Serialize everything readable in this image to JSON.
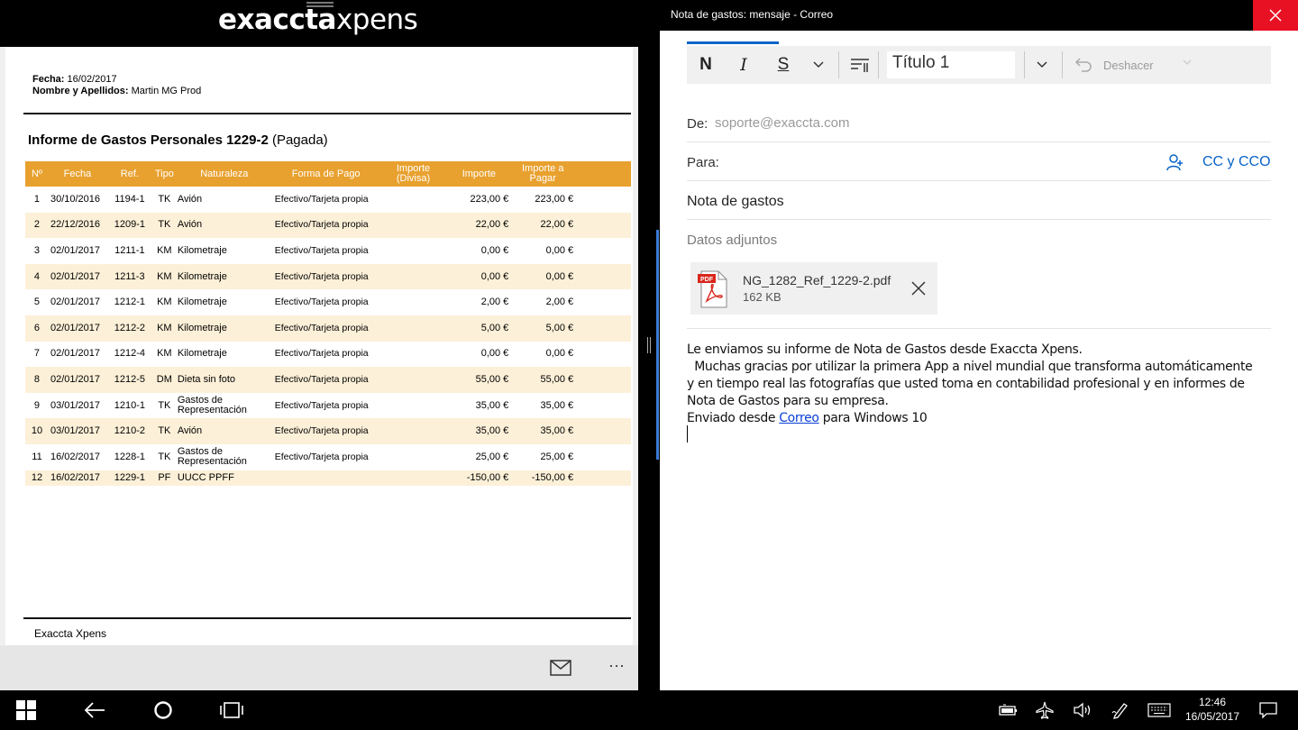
{
  "left_app": {
    "logo_bold": "exaccta",
    "logo_light": "xpens",
    "report": {
      "fecha_label": "Fecha:",
      "fecha_value": "16/02/2017",
      "nombre_label": "Nombre y Apellidos:",
      "nombre_value": "Martin MG Prod",
      "title": "Informe de Gastos Personales 1229-2",
      "status": "(Pagada)",
      "columns": [
        "Nº",
        "Fecha",
        "Ref.",
        "Tipo",
        "Naturaleza",
        "Forma de Pago",
        "Importe (Divisa)",
        "Importe",
        "Importe a Pagar"
      ],
      "rows": [
        {
          "n": "1",
          "fecha": "30/10/2016",
          "ref": "1194-1",
          "tipo": "TK",
          "naturaleza": "Avión",
          "forma_pago": "Efectivo/Tarjeta propia",
          "importe_divisa": "",
          "importe": "223,00 €",
          "importe_pagar": "223,00 €"
        },
        {
          "n": "2",
          "fecha": "22/12/2016",
          "ref": "1209-1",
          "tipo": "TK",
          "naturaleza": "Avión",
          "forma_pago": "Efectivo/Tarjeta propia",
          "importe_divisa": "",
          "importe": "22,00 €",
          "importe_pagar": "22,00 €"
        },
        {
          "n": "3",
          "fecha": "02/01/2017",
          "ref": "1211-1",
          "tipo": "KM",
          "naturaleza": "Kilometraje",
          "forma_pago": "Efectivo/Tarjeta propia",
          "importe_divisa": "",
          "importe": "0,00 €",
          "importe_pagar": "0,00 €"
        },
        {
          "n": "4",
          "fecha": "02/01/2017",
          "ref": "1211-3",
          "tipo": "KM",
          "naturaleza": "Kilometraje",
          "forma_pago": "Efectivo/Tarjeta propia",
          "importe_divisa": "",
          "importe": "0,00 €",
          "importe_pagar": "0,00 €"
        },
        {
          "n": "5",
          "fecha": "02/01/2017",
          "ref": "1212-1",
          "tipo": "KM",
          "naturaleza": "Kilometraje",
          "forma_pago": "Efectivo/Tarjeta propia",
          "importe_divisa": "",
          "importe": "2,00 €",
          "importe_pagar": "2,00 €"
        },
        {
          "n": "6",
          "fecha": "02/01/2017",
          "ref": "1212-2",
          "tipo": "KM",
          "naturaleza": "Kilometraje",
          "forma_pago": "Efectivo/Tarjeta propia",
          "importe_divisa": "",
          "importe": "5,00 €",
          "importe_pagar": "5,00 €"
        },
        {
          "n": "7",
          "fecha": "02/01/2017",
          "ref": "1212-4",
          "tipo": "KM",
          "naturaleza": "Kilometraje",
          "forma_pago": "Efectivo/Tarjeta propia",
          "importe_divisa": "",
          "importe": "0,00 €",
          "importe_pagar": "0,00 €"
        },
        {
          "n": "8",
          "fecha": "02/01/2017",
          "ref": "1212-5",
          "tipo": "DM",
          "naturaleza": "Dieta sin foto",
          "forma_pago": "Efectivo/Tarjeta propia",
          "importe_divisa": "",
          "importe": "55,00 €",
          "importe_pagar": "55,00 €"
        },
        {
          "n": "9",
          "fecha": "03/01/2017",
          "ref": "1210-1",
          "tipo": "TK",
          "naturaleza": "Gastos de Representación",
          "forma_pago": "Efectivo/Tarjeta propia",
          "importe_divisa": "",
          "importe": "35,00 €",
          "importe_pagar": "35,00 €"
        },
        {
          "n": "10",
          "fecha": "03/01/2017",
          "ref": "1210-2",
          "tipo": "TK",
          "naturaleza": "Avión",
          "forma_pago": "Efectivo/Tarjeta propia",
          "importe_divisa": "",
          "importe": "35,00 €",
          "importe_pagar": "35,00 €"
        },
        {
          "n": "11",
          "fecha": "16/02/2017",
          "ref": "1228-1",
          "tipo": "TK",
          "naturaleza": "Gastos de Representación",
          "forma_pago": "Efectivo/Tarjeta propia",
          "importe_divisa": "",
          "importe": "25,00 €",
          "importe_pagar": "25,00 €"
        },
        {
          "n": "12",
          "fecha": "16/02/2017",
          "ref": "1229-1",
          "tipo": "PF",
          "naturaleza": "UUCC PPFF",
          "forma_pago": "",
          "importe_divisa": "",
          "importe": "-150,00 €",
          "importe_pagar": "-150,00 €"
        }
      ],
      "footer": "Exaccta Xpens"
    },
    "accent_color": "#e8a12f"
  },
  "mail": {
    "window_title": "Nota de gastos: mensaje - Correo",
    "toolbar": {
      "bold": "N",
      "italic": "I",
      "underline": "S",
      "style_value": "Título 1",
      "undo_label": "Deshacer"
    },
    "from_label": "De:",
    "from_value": "soporte@exaccta.com",
    "to_label": "Para:",
    "cc_label": "CC y CCO",
    "subject": "Nota de gastos",
    "attachments_label": "Datos adjuntos",
    "attachment": {
      "name": "NG_1282_Ref_1229-2.pdf",
      "size": "162 KB",
      "badge": "PDF"
    },
    "body": {
      "line1": "Le enviamos su informe de Nota de Gastos desde Exaccta Xpens.",
      "line2": "  Muchas gracias por utilizar la primera App a nivel mundial que transforma automáticamente y en tiempo real las fotografías que usted toma en contabilidad profesional y en informes de Nota de Gastos para su empresa.",
      "sent_prefix": "Enviado desde ",
      "sent_link": "Correo",
      "sent_suffix": " para Windows 10"
    },
    "accent_color": "#0a64c8"
  },
  "taskbar": {
    "time": "12:46",
    "date": "16/05/2017"
  }
}
